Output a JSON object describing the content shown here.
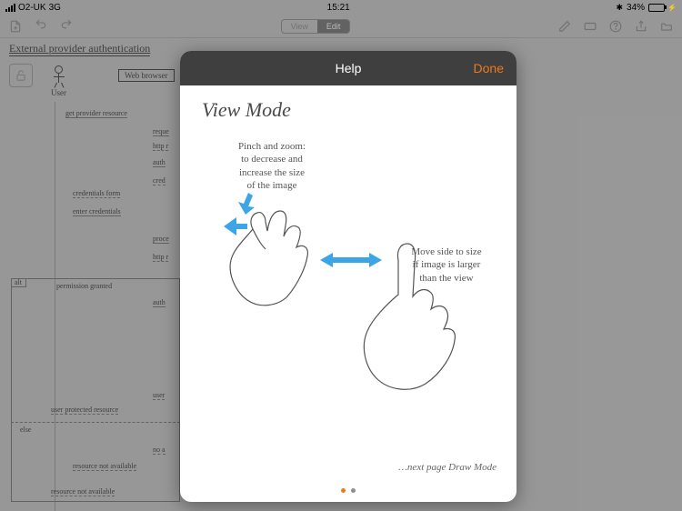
{
  "status": {
    "carrier": "O2-UK",
    "network": "3G",
    "time": "15:21",
    "bt_icon": "✱",
    "battery_pct": "34%"
  },
  "toolbar": {
    "mode_view": "View",
    "mode_edit": "Edit"
  },
  "diagram": {
    "title": "External provider authentication",
    "actor": "User",
    "box_browser": "Web browser",
    "msgs": {
      "m1": "get provider resource",
      "m2": "reque",
      "m3": "http r",
      "m4": "auth",
      "m5": "cred",
      "m6": "credentials form",
      "m7": "enter credentials",
      "m8": "proce",
      "m9": "http r",
      "alt": "alt",
      "perm": "permission granted",
      "m10": "auth",
      "m11": "user",
      "m12": "user protected resource",
      "else": "else",
      "m13": "no a",
      "m14": "resource not available",
      "m15": "resource not available"
    }
  },
  "modal": {
    "header_title": "Help",
    "done": "Done",
    "page_title": "View Mode",
    "pinch_text_l1": "Pinch and zoom:",
    "pinch_text_l2": "to decrease and",
    "pinch_text_l3": "increase the size",
    "pinch_text_l4": "of the image",
    "pan_text_l1": "Move side to size",
    "pan_text_l2": "if image is larger",
    "pan_text_l3": "than the view",
    "next_page": "…next page Draw Mode"
  }
}
